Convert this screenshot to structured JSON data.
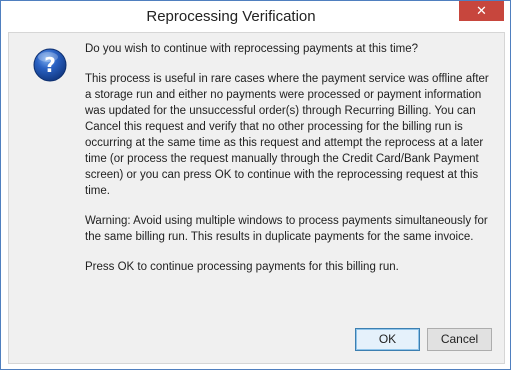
{
  "dialog": {
    "title": "Reprocessing Verification",
    "close_label": "✕",
    "icon": "question-icon",
    "message": {
      "question": "Do you wish to continue with reprocessing payments at this time?",
      "explanation": "This process is useful in rare cases where the payment service was offline after a storage run and either no payments were processed or payment information was updated for the unsuccessful order(s) through Recurring Billing. You can Cancel this request and verify that no other processing for the billing run is occurring at the same time as this request and attempt the reprocess at a later time (or process the request manually through the Credit Card/Bank Payment screen) or you can press OK to continue with the reprocessing request at this time.",
      "warning": "Warning: Avoid using multiple windows to process payments simultaneously for the same billing run. This results in duplicate payments for the same invoice.",
      "instruction": "Press OK to continue processing payments for this billing run."
    },
    "buttons": {
      "ok_label": "OK",
      "cancel_label": "Cancel"
    },
    "colors": {
      "close_button": "#c7463d",
      "icon_blue": "#1c4fa3",
      "window_border": "#4f7fbf"
    }
  }
}
